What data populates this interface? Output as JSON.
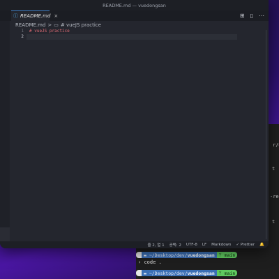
{
  "window": {
    "title": "README.md — vuedongsan"
  },
  "tab": {
    "label": "README.md",
    "close": "×"
  },
  "tab_actions": [
    "⊞",
    "▯",
    "⋯"
  ],
  "breadcrumb": {
    "file": "README.md",
    "separator": ">",
    "section": "# vueJS practice"
  },
  "editor": {
    "line_numbers": [
      "1",
      "2"
    ],
    "lines": [
      "# vueJS practice",
      ""
    ]
  },
  "statusbar": {
    "position": "줄 2, 열 1",
    "spaces": "공백: 2",
    "encoding": "UTF-8",
    "eol": "LF",
    "language": "Markdown",
    "prettier": "✓ Prettier",
    "notifications": "🔔"
  },
  "terminal": {
    "clipped_lines": [
      "r/dis",
      "t",
      "-reus",
      "t"
    ],
    "prompt1": {
      "apple": "",
      "path_prefix": "~/Desktop/dev/",
      "path_bold": "vuedongsan",
      "git": "main"
    },
    "command": "code .",
    "prompt2": {
      "apple": "",
      "path_prefix": "~/Desktop/dev/",
      "path_bold": "vuedongsan",
      "git": "main"
    }
  }
}
